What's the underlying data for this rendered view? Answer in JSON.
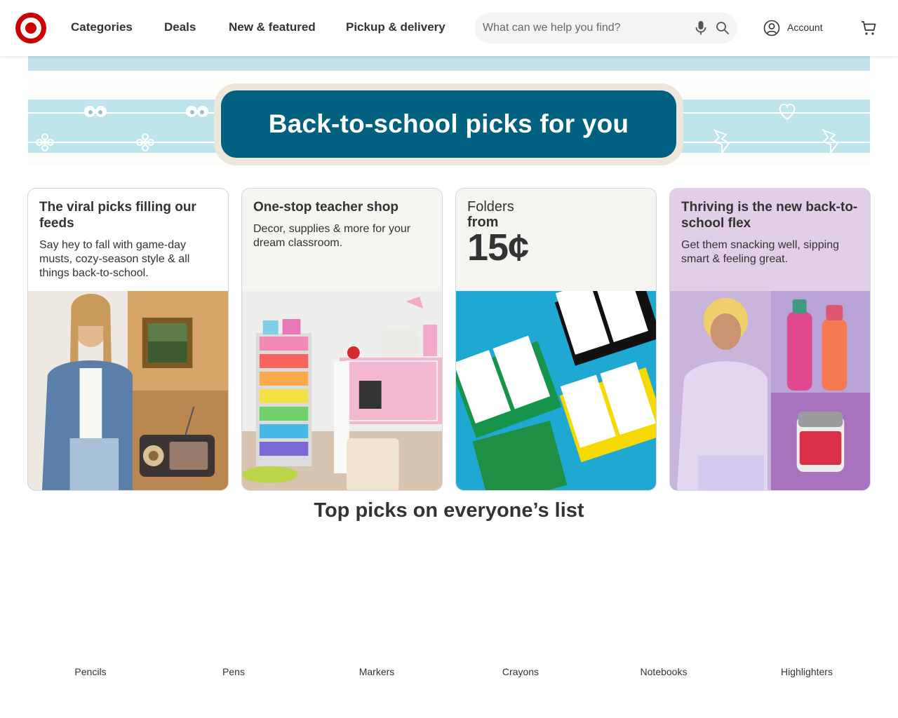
{
  "header": {
    "nav": [
      {
        "label": "Categories"
      },
      {
        "label": "Deals"
      },
      {
        "label": "New & featured"
      },
      {
        "label": "Pickup & delivery"
      }
    ],
    "search": {
      "placeholder": "What can we help you find?",
      "value": ""
    },
    "account_label": "Account",
    "brand_color": "#cc0000"
  },
  "banner": {
    "title": "Back-to-school picks for you",
    "pill_color": "#00607f",
    "band_color": "#bfe5ec"
  },
  "cards": [
    {
      "title": "The viral picks filling our feeds",
      "description": "Say hey to fall with game-day musts, cozy-season style & all things back-to-school.",
      "bg": "#ffffff"
    },
    {
      "title": "One-stop teacher shop",
      "description": "Decor, supplies & more for your dream classroom.",
      "bg": "#f5f4f1"
    },
    {
      "line1": "Folders",
      "line2": "from",
      "price": "15¢",
      "bg": "#f5f4f1"
    },
    {
      "title": "Thriving is the new back-to-school flex",
      "description": "Get them snacking well, sipping smart & feeling great.",
      "bg": "#e0cfe6"
    }
  ],
  "top_picks": {
    "title": "Top picks on everyone’s list",
    "items": [
      {
        "label": "Pencils"
      },
      {
        "label": "Pens"
      },
      {
        "label": "Markers"
      },
      {
        "label": "Crayons"
      },
      {
        "label": "Notebooks"
      },
      {
        "label": "Highlighters"
      }
    ]
  },
  "icons": {
    "logo": "target-bullseye-logo",
    "mic": "microphone-icon",
    "search": "search-icon",
    "account": "account-circle-icon",
    "cart": "shopping-cart-icon"
  }
}
